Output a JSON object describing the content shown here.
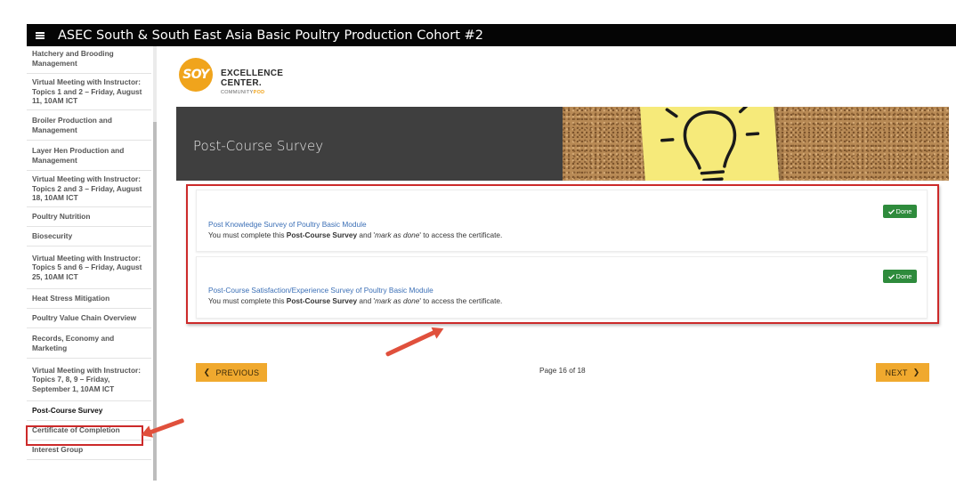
{
  "topbar": {
    "title": "ASEC South & South East Asia Basic Poultry Production Cohort #2",
    "menu_icon": "hamburger-menu-icon"
  },
  "sidebar": {
    "items": [
      {
        "label": "Hatchery and Brooding Management",
        "active": false
      },
      {
        "label": "Virtual Meeting with Instructor: Topics 1 and 2 – Friday, August 11, 10AM ICT",
        "active": false
      },
      {
        "label": "Broiler Production and Management",
        "active": false
      },
      {
        "label": "Layer Hen Production and Management",
        "active": false
      },
      {
        "label": "Virtual Meeting with Instructor: Topics 2 and 3 – Friday, August 18, 10AM ICT",
        "active": false
      },
      {
        "label": "Poultry Nutrition",
        "active": false
      },
      {
        "label": "Biosecurity",
        "active": false
      },
      {
        "label": "Virtual Meeting with Instructor: Topics 5 and 6 – Friday, August 25, 10AM ICT",
        "active": false
      },
      {
        "label": "Heat Stress Mitigation",
        "active": false
      },
      {
        "label": "Poultry Value Chain Overview",
        "active": false
      },
      {
        "label": "Records, Economy and Marketing",
        "active": false
      },
      {
        "label": "Virtual Meeting with Instructor: Topics 7, 8, 9 – Friday, September 1, 10AM ICT",
        "active": false
      },
      {
        "label": "Post-Course Survey",
        "active": true
      },
      {
        "label": "Certificate of Completion",
        "active": false
      },
      {
        "label": "Interest Group",
        "active": false
      }
    ]
  },
  "logo": {
    "mark": "SOY",
    "line1": "EXCELLENCE",
    "line2": "CENTER.",
    "line3_prefix": "COMMUNITY",
    "line3_pod": "POD"
  },
  "banner": {
    "title": "Post-Course Survey"
  },
  "surveys": [
    {
      "link": "Post Knowledge Survey of Poultry Basic Module",
      "note_prefix": "You must complete this ",
      "note_bold": "Post-Course Survey",
      "note_mid": " and '",
      "note_italic": "mark as done",
      "note_suffix": "' to access the certificate.",
      "status": "Done"
    },
    {
      "link": "Post-Course Satisfaction/Experience Survey of Poultry Basic Module",
      "note_prefix": "You must complete this ",
      "note_bold": "Post-Course Survey",
      "note_mid": " and '",
      "note_italic": "mark as done",
      "note_suffix": "' to access the certificate.",
      "status": "Done"
    }
  ],
  "pagination": {
    "prev_label": "PREVIOUS",
    "next_label": "NEXT",
    "page_text": "Page 16 of 18"
  },
  "colors": {
    "accent_orange": "#f0a92e",
    "done_green": "#2e8b3c",
    "highlight_red": "#cc2a2a",
    "link_blue": "#3b6fb6",
    "banner_dark": "#3f3f3f"
  }
}
